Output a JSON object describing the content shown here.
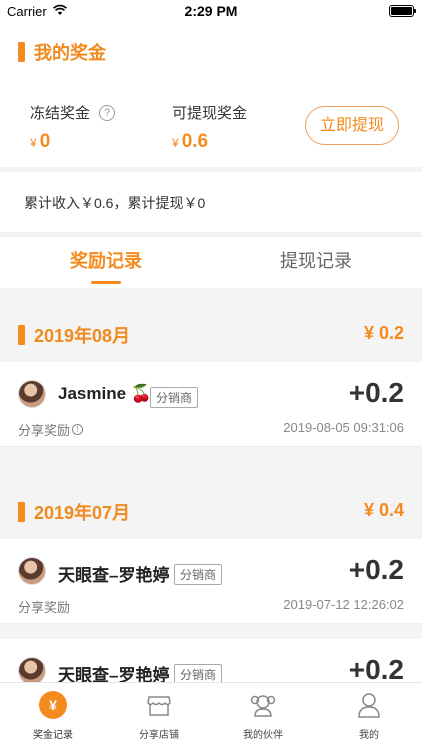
{
  "status_bar": {
    "carrier": "Carrier",
    "time": "2:29 PM"
  },
  "header": {
    "title": "我的奖金",
    "frozen": {
      "label": "冻结奖金",
      "currency": "¥",
      "value": "0"
    },
    "withdrawable": {
      "label": "可提现奖金",
      "currency": "¥",
      "value": "0.6"
    },
    "withdraw_button": "立即提现"
  },
  "summary": "累计收入￥0.6，累计提现￥0",
  "tabs": [
    {
      "label": "奖励记录"
    },
    {
      "label": "提现记录"
    }
  ],
  "months": [
    {
      "month": "2019年08月",
      "amount": "¥ 0.2",
      "records": [
        {
          "name": "Jasmine 🍒",
          "badge": "分销商",
          "delta": "+0.2",
          "type": "分享奖励",
          "time": "2019-08-05 09:31:06"
        }
      ]
    },
    {
      "month": "2019年07月",
      "amount": "¥ 0.4",
      "records": [
        {
          "name": "天眼查–罗艳婷",
          "badge": "分销商",
          "delta": "+0.2",
          "type": "分享奖励",
          "time": "2019-07-12 12:26:02"
        },
        {
          "name": "天眼查–罗艳婷",
          "badge": "分销商",
          "delta": "+0.2"
        }
      ]
    }
  ],
  "tabbar": [
    {
      "label": "奖金记录",
      "icon": "yen-icon"
    },
    {
      "label": "分享店铺",
      "icon": "store-icon"
    },
    {
      "label": "我的伙伴",
      "icon": "partner-icon"
    },
    {
      "label": "我的",
      "icon": "user-icon"
    }
  ],
  "colors": {
    "accent": "#f58a1e"
  }
}
